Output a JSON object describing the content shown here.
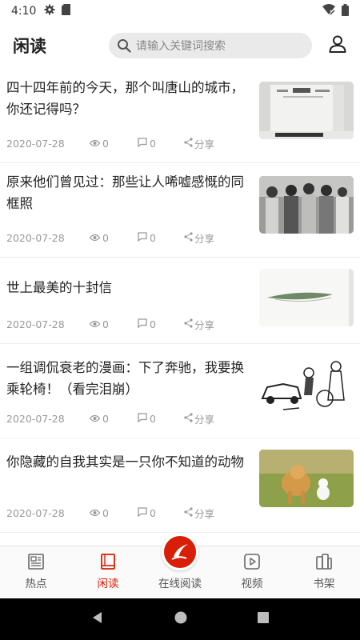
{
  "status_bar": {
    "time": "4:10",
    "icons": [
      "gear-icon",
      "sim-card-icon",
      "wifi-icon",
      "battery-icon"
    ]
  },
  "header": {
    "title": "闲读",
    "search_placeholder": "请输入关键词搜索"
  },
  "articles": [
    {
      "title": "四十四年前的今天，那个叫唐山的城市，你还记得吗？",
      "date": "2020-07-28",
      "views": "0",
      "comments": "0",
      "share": "分享"
    },
    {
      "title": "原来他们曾见过：那些让人唏嘘感慨的同框照",
      "date": "2020-07-28",
      "views": "0",
      "comments": "0",
      "share": "分享"
    },
    {
      "title": "世上最美的十封信",
      "date": "2020-07-28",
      "views": "0",
      "comments": "0",
      "share": "分享"
    },
    {
      "title": "一组调侃衰老的漫画：下了奔驰，我要换乘轮椅！（看完泪崩）",
      "date": "2020-07-28",
      "views": "0",
      "comments": "0",
      "share": "分享"
    },
    {
      "title": "你隐藏的自我其实是一只你不知道的动物",
      "date": "2020-07-28",
      "views": "0",
      "comments": "0",
      "share": "分享"
    }
  ],
  "tabs": [
    {
      "label": "热点",
      "icon": "newspaper-icon"
    },
    {
      "label": "闲读",
      "icon": "book-icon"
    },
    {
      "label": "在线阅读",
      "icon": "app-logo-icon"
    },
    {
      "label": "视频",
      "icon": "play-icon"
    },
    {
      "label": "书架",
      "icon": "bookshelf-icon"
    }
  ],
  "colors": {
    "accent": "#d81e06",
    "meta_text": "#999999"
  }
}
